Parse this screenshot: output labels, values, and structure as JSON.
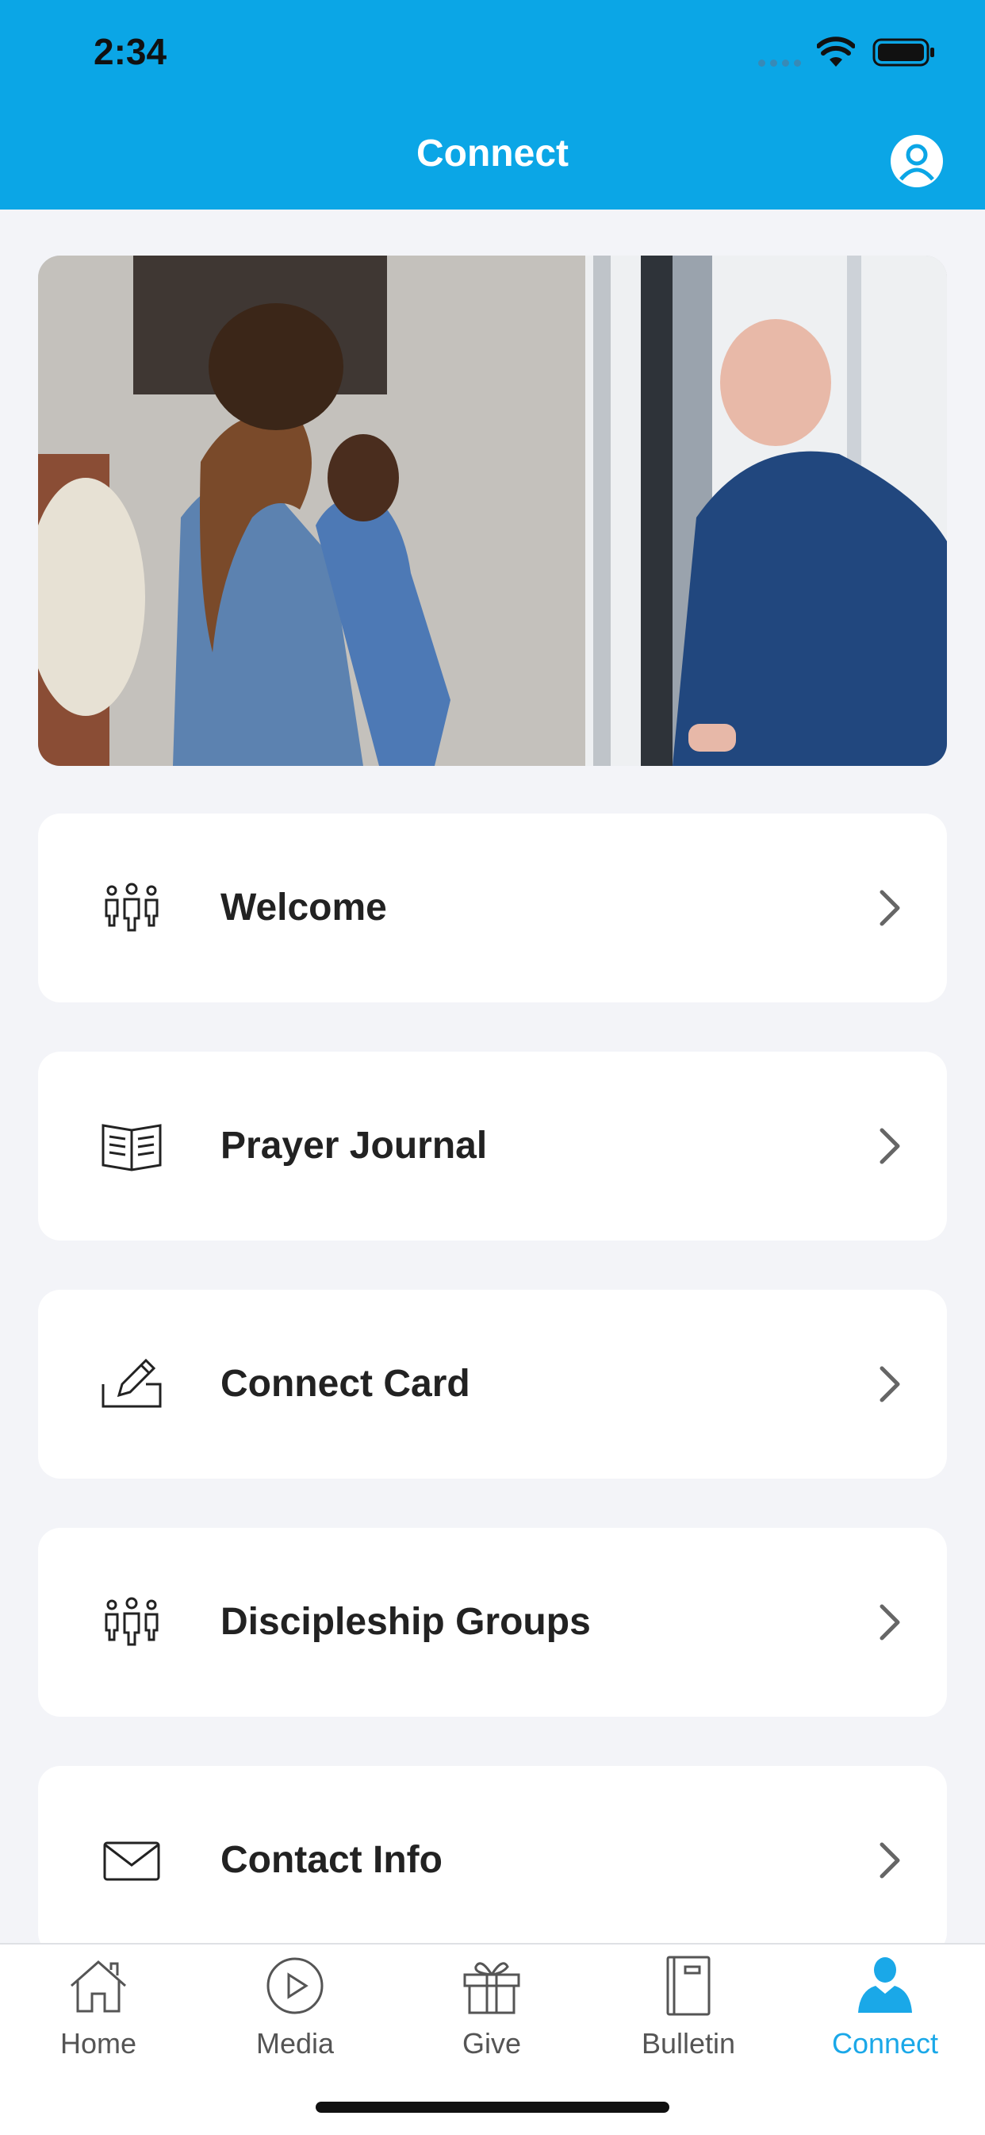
{
  "status_bar": {
    "time": "2:34"
  },
  "header": {
    "title": "Connect",
    "bg_color": "#0ba6e6",
    "profile_icon": "user-circle-icon"
  },
  "hero": {
    "description": "photo"
  },
  "menu": [
    {
      "label": "Welcome",
      "icon": "people-group-icon"
    },
    {
      "label": "Prayer Journal",
      "icon": "open-book-icon"
    },
    {
      "label": "Connect Card",
      "icon": "pencil-card-icon"
    },
    {
      "label": "Discipleship Groups",
      "icon": "people-group-icon"
    },
    {
      "label": "Contact Info",
      "icon": "envelope-icon"
    }
  ],
  "tabbar": {
    "active_color": "#1aa8e8",
    "tabs": [
      {
        "label": "Home",
        "icon": "home-icon"
      },
      {
        "label": "Media",
        "icon": "play-circle-icon"
      },
      {
        "label": "Give",
        "icon": "gift-icon"
      },
      {
        "label": "Bulletin",
        "icon": "bulletin-book-icon"
      },
      {
        "label": "Connect",
        "icon": "person-icon",
        "active": true
      }
    ]
  }
}
